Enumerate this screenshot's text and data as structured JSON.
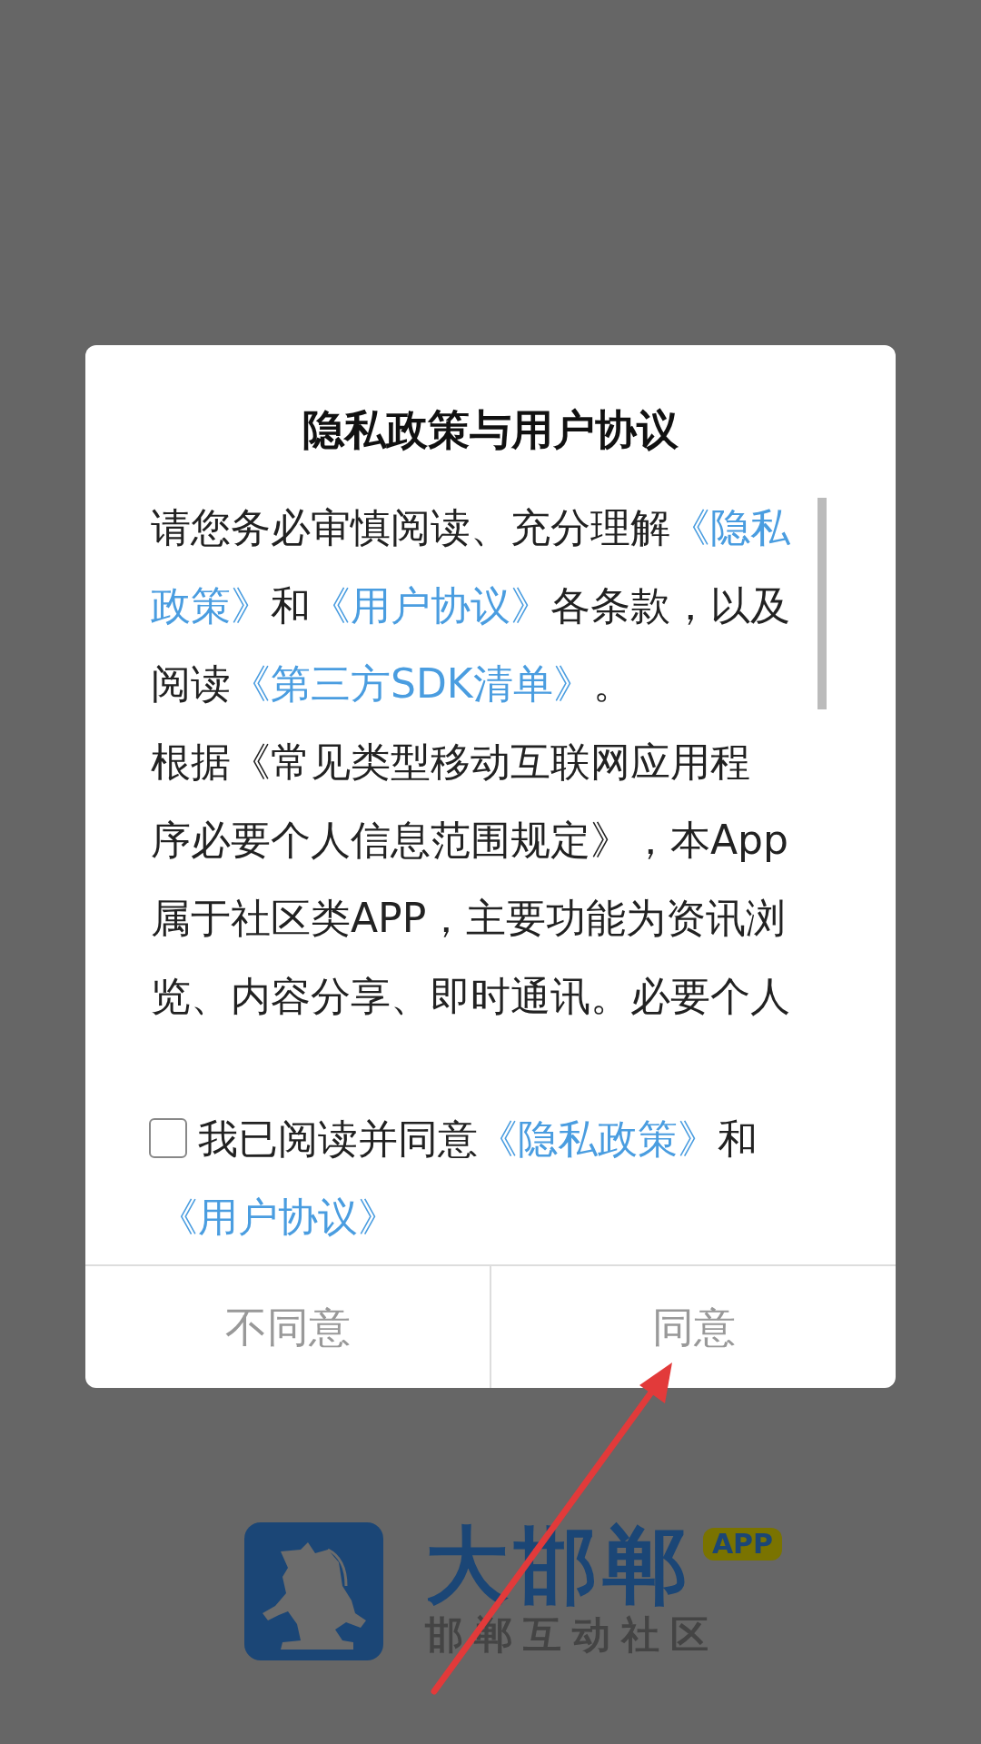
{
  "dialog": {
    "title": "隐私政策与用户协议",
    "paragraphs": [
      {
        "lines": [
          [
            {
              "text": "请您务必审慎阅读、充分理解"
            },
            {
              "text": "《隐私",
              "link": true
            }
          ],
          [
            {
              "text": "政策》",
              "link": true
            },
            {
              "text": "和"
            },
            {
              "text": "《用户协议》",
              "link": true
            },
            {
              "text": "各条款，以及"
            }
          ],
          [
            {
              "text": "阅读"
            },
            {
              "text": "《第三方SDK清单》",
              "link": true
            },
            {
              "text": "。"
            }
          ]
        ]
      },
      {
        "lines": [
          [
            {
              "text": "根据《常见类型移动互联网应用程"
            }
          ],
          [
            {
              "text": "序必要个人信息范围规定》，本App"
            }
          ],
          [
            {
              "text": "属于社区类APP，主要功能为资讯浏"
            }
          ],
          [
            {
              "text": "览、内容分享、即时通讯。必要个人"
            }
          ]
        ]
      }
    ],
    "agreement": {
      "checked": false,
      "lines": [
        [
          {
            "text": "我已阅读并同意"
          },
          {
            "text": "《隐私政策》",
            "link": true
          },
          {
            "text": "和"
          }
        ],
        [
          {
            "text": "《用户协议》",
            "link": true
          }
        ]
      ]
    },
    "buttons": [
      {
        "label": "不同意"
      },
      {
        "label": "同意"
      }
    ]
  },
  "logo": {
    "name": "大邯郸",
    "badge": "APP",
    "tagline": "邯郸互动社区"
  }
}
